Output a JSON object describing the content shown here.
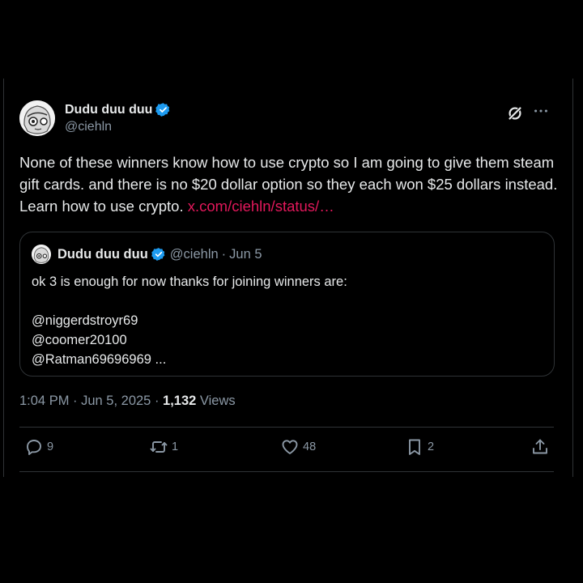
{
  "tweet": {
    "author": {
      "display_name": "Dudu duu duu",
      "handle": "@ciehln",
      "verified": true
    },
    "text": "None of these winners know how to use crypto so I am going to give them steam gift cards. and there is no $20 dollar option so they each won $25 dollars instead. Learn how to use crypto. ",
    "link_text": "x.com/ciehln/status/…",
    "timestamp": "1:04 PM · Jun 5, 2025",
    "views_separator": " · ",
    "views_count": "1,132",
    "views_label": "Views"
  },
  "quote": {
    "display_name": "Dudu duu duu",
    "handle": "@ciehln",
    "separator": "·",
    "date": "Jun 5",
    "text": "ok 3 is enough for now thanks for joining winners are:\n\n@niggerdstroyr69\n@coomer20100\n@Ratman69696969 ..."
  },
  "actions": {
    "replies": "9",
    "reposts": "1",
    "likes": "48",
    "bookmarks": "2"
  },
  "icons": {
    "header": [
      "grok-icon",
      "more-icon"
    ],
    "actions": [
      "reply-icon",
      "repost-icon",
      "like-icon",
      "bookmark-icon",
      "share-icon"
    ]
  },
  "colors": {
    "background": "#000000",
    "text": "#e7e9ea",
    "secondary": "#8b98a5",
    "link": "#e2185b",
    "verified": "#1d9bf0",
    "border": "#2f3336"
  }
}
